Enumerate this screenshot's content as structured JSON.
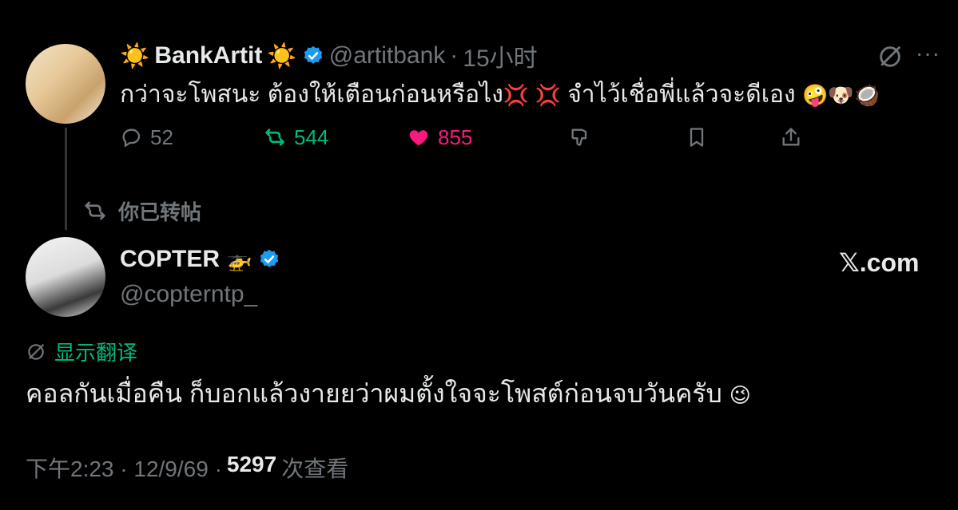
{
  "first_tweet": {
    "display_name": "BankArtit",
    "name_decoration": "☀️",
    "handle": "@artitbank",
    "separator": "·",
    "time": "15小时",
    "text": "กว่าจะโพสนะ ต้องให้เตือนก่อนหรือไง",
    "text_emojis_1": "💢 💢",
    "text_after": "จำไว้เชื่อพี่แล้วจะดีเอง",
    "text_emojis_2": "🤪🐶🥥",
    "actions": {
      "replies": "52",
      "retweets": "544",
      "likes": "855"
    },
    "icons": [
      "grok-icon",
      "more-icon",
      "reply-icon",
      "retweet-icon",
      "heart-icon",
      "dislike-icon",
      "bookmark-icon",
      "share-icon"
    ]
  },
  "repost_label": "你已转帖",
  "quoted_tweet": {
    "display_name": "COPTER",
    "name_emoji": "🚁",
    "handle": "@copterntp_",
    "source": "𝕏.com",
    "translate_label": "显示翻译",
    "text": "คอลกันเมื่อคืน ก็บอกแล้วงายยว่าผมตั้งใจจะโพสต์ก่อนจบวันครับ",
    "text_emoji": "😉",
    "timestamp": "下午2:23 · 12/9/69 ·",
    "views_count": "5297",
    "views_label": "次查看"
  },
  "colors": {
    "background": "#000000",
    "text": "#e7e9ea",
    "muted": "#71767b",
    "retweet": "#00ba7c",
    "like": "#f91880",
    "verified": "#1d9bf0"
  }
}
